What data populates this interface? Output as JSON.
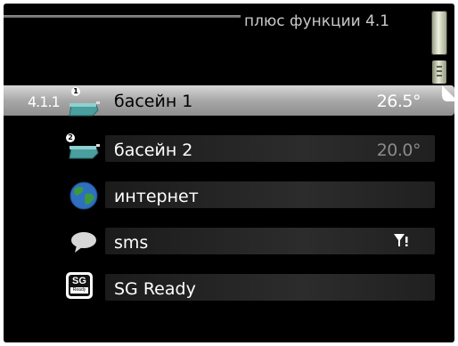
{
  "header": {
    "title": "плюс функции 4.1"
  },
  "menu": {
    "items": [
      {
        "number": "4.1.1",
        "label": "басейн 1",
        "value": "26.5°",
        "icon": "pool-icon",
        "badge": "1"
      },
      {
        "label": "басейн 2",
        "value": "20.0°",
        "icon": "pool-icon",
        "badge": "2"
      },
      {
        "label": "интернет",
        "icon": "globe-icon"
      },
      {
        "label": "sms",
        "icon": "speech-bubble-icon",
        "status_icon": "no-signal-icon"
      },
      {
        "label": "SG Ready",
        "icon": "sg-ready-icon",
        "icon_text_top": "SG",
        "icon_text_bottom": "Ready"
      }
    ]
  }
}
